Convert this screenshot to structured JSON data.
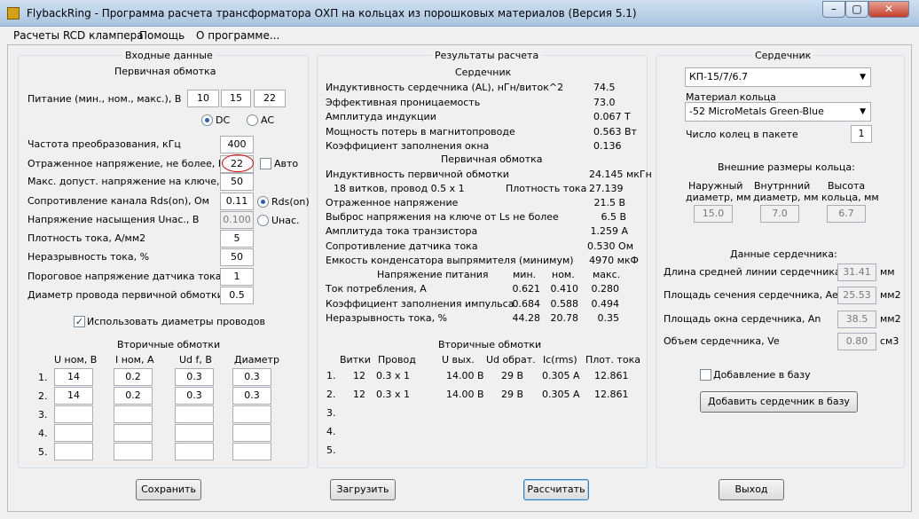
{
  "titlebar": {
    "title": "FlybackRing - Программа расчета трансформатора ОХП на кольцах из порошковых материалов (Версия 5.1)"
  },
  "menu": [
    "Расчеты RCD клампера",
    "Помощь",
    "О программе..."
  ],
  "input": {
    "title": "Входные данные",
    "primary_title": "Первичная обмотка",
    "supply_label": "Питание (мин., ном., макс.), В",
    "supply": [
      "10",
      "15",
      "22"
    ],
    "dc_label": "DC",
    "ac_label": "AC",
    "rows": [
      {
        "label": "Частота преобразования, кГц",
        "value": "400"
      },
      {
        "label": "Отраженное напряжение, не более, В",
        "value": "22"
      },
      {
        "label": "Макс. допуст. напряжение на ключе, В",
        "value": "50"
      },
      {
        "label": "Сопротивление канала Rds(on), Ом",
        "value": "0.11"
      },
      {
        "label": "Напряжение насыщения Uнас., В",
        "value": "0.100"
      },
      {
        "label": "Плотность тока, А/мм2",
        "value": "5"
      },
      {
        "label": "Неразрывность тока, %",
        "value": "50"
      },
      {
        "label": "Пороговое напряжение датчика тока, В",
        "value": "1"
      },
      {
        "label": "Диаметр провода первичной обмотки",
        "value": "0.5"
      }
    ],
    "auto_label": "Авто",
    "rds_label": "Rds(on)",
    "usat_label": "Uнас.",
    "use_diam_label": "Использовать диаметры проводов",
    "secondary_title": "Вторичные обмотки",
    "sec_headers": [
      "U ном, В",
      "I ном, А",
      "Ud f, В",
      "Диаметр"
    ],
    "sec_nums": [
      "1.",
      "2.",
      "3.",
      "4.",
      "5."
    ],
    "sec_values": [
      [
        "14",
        "0.2",
        "0.3",
        "0.3"
      ],
      [
        "14",
        "0.2",
        "0.3",
        "0.3"
      ],
      [
        "",
        "",
        "",
        ""
      ],
      [
        "",
        "",
        "",
        ""
      ],
      [
        "",
        "",
        "",
        ""
      ]
    ]
  },
  "results": {
    "title": "Результаты расчета",
    "core_title": "Сердечник",
    "core_rows": [
      {
        "label": "Индуктивность сердечника (AL), нГн/виток^2",
        "value": "74.5"
      },
      {
        "label": "Эффективная проницаемость",
        "value": "73.0"
      },
      {
        "label": "Амплитуда индукции",
        "value": "0.067 Т"
      },
      {
        "label": "Мощность потерь в магнитопроводе",
        "value": "0.563 Вт"
      },
      {
        "label": "Коэффициент заполнения окна",
        "value": "0.136"
      }
    ],
    "primary_title": "Первичная обмотка",
    "prim_inductance_label": "Индуктивность первичной обмотки",
    "prim_inductance_value": "24.145 мкГн",
    "turns_label": "18 витков, провод 0.5 x 1",
    "density_label": "Плотность тока",
    "density_value": "27.139",
    "prim_rows": [
      {
        "label": "Отраженное напряжение",
        "value": "21.5 В"
      },
      {
        "label": "Выброс напряжения на ключе от Ls не более",
        "value": "6.5 В"
      },
      {
        "label": "Амплитуда тока транзистора",
        "value": "1.259 А"
      },
      {
        "label": "Сопротивление датчика тока",
        "value": "0.530 Ом"
      },
      {
        "label": "Емкость конденсатора выпрямителя (минимум)",
        "value": "4970 мкФ"
      }
    ],
    "supply_header": "Напряжение питания",
    "supply_cols": [
      "мин.",
      "ном.",
      "макс."
    ],
    "supply_rows": [
      {
        "label": "Ток потребления, А",
        "values": [
          "0.621",
          "0.410",
          "0.280"
        ]
      },
      {
        "label": "Коэффициент заполнения импульса",
        "values": [
          "0.684",
          "0.588",
          "0.494"
        ]
      },
      {
        "label": "Неразрывность тока, %",
        "values": [
          "44.28",
          "20.78",
          "0.35"
        ]
      }
    ],
    "secondary_title": "Вторичные обмотки",
    "sec_headers": [
      "Витки",
      "Провод",
      "U вых.",
      "Ud обрат.",
      "Ic(rms)",
      "Плот. тока"
    ],
    "sec_nums": [
      "1.",
      "2.",
      "3.",
      "4.",
      "5."
    ],
    "sec_rows": [
      [
        "12",
        "0.3 x 1",
        "14.00 В",
        "29 В",
        "0.305 А",
        "12.861"
      ],
      [
        "12",
        "0.3 x 1",
        "14.00 В",
        "29 В",
        "0.305 А",
        "12.861"
      ]
    ]
  },
  "core": {
    "title": "Сердечник",
    "core_select": "КП-15/7/6.7",
    "material_label": "Материал кольца",
    "material_select": "-52 MicroMetals Green-Blue",
    "rings_label": "Число колец в пакете",
    "rings_value": "1",
    "dims_title": "Внешние размеры кольца:",
    "dim_labels": [
      [
        "Наружный",
        "диаметр, мм"
      ],
      [
        "Внутрнний",
        "диаметр, мм"
      ],
      [
        "Высота",
        "кольца, мм"
      ]
    ],
    "dim_values": [
      "15.0",
      "7.0",
      "6.7"
    ],
    "data_title": "Данные сердечника:",
    "data_rows": [
      {
        "label": "Длина средней линии сердечника, le",
        "value": "31.41",
        "unit": "мм"
      },
      {
        "label": "Площадь сечения сердечника, Ae",
        "value": "25.53",
        "unit": "мм2"
      },
      {
        "label": "Площадь окна сердечника, An",
        "value": "38.5",
        "unit": "мм2"
      },
      {
        "label": "Объем сердечника, Ve",
        "value": "0.80",
        "unit": "см3"
      }
    ],
    "add_db_check_label": "Добавление в базу",
    "add_core_button": "Добавить сердечник в базу"
  },
  "buttons": {
    "save": "Сохранить",
    "load": "Загрузить",
    "calc": "Рассчитать",
    "exit": "Выход"
  },
  "colors": {
    "window_bg": "#f0f0f0",
    "titlebar": "#a9c4e0",
    "annotation_circle": "#dd0000"
  }
}
